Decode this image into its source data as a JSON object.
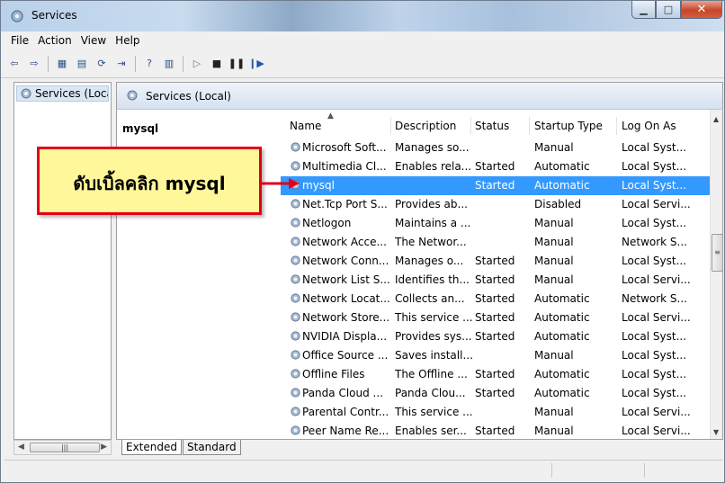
{
  "window": {
    "title": "Services"
  },
  "menu": [
    "File",
    "Action",
    "View",
    "Help"
  ],
  "tree": {
    "root_label": "Services (Loca"
  },
  "right_pane": {
    "header": "Services (Local)",
    "selected_service_name": "mysql"
  },
  "columns": [
    "Name",
    "Description",
    "Status",
    "Startup Type",
    "Log On As"
  ],
  "rows": [
    {
      "name": "Microsoft Soft...",
      "description": "Manages so...",
      "status": "",
      "startup": "Manual",
      "logon": "Local Syst..."
    },
    {
      "name": "Multimedia Cl...",
      "description": "Enables rela...",
      "status": "Started",
      "startup": "Automatic",
      "logon": "Local Syst..."
    },
    {
      "name": "mysql",
      "description": "",
      "status": "Started",
      "startup": "Automatic",
      "logon": "Local Syst...",
      "selected": true
    },
    {
      "name": "Net.Tcp Port S...",
      "description": "Provides ab...",
      "status": "",
      "startup": "Disabled",
      "logon": "Local Servi..."
    },
    {
      "name": "Netlogon",
      "description": "Maintains a ...",
      "status": "",
      "startup": "Manual",
      "logon": "Local Syst..."
    },
    {
      "name": "Network Acce...",
      "description": "The Networ...",
      "status": "",
      "startup": "Manual",
      "logon": "Network S..."
    },
    {
      "name": "Network Conn...",
      "description": "Manages o...",
      "status": "Started",
      "startup": "Manual",
      "logon": "Local Syst..."
    },
    {
      "name": "Network List S...",
      "description": "Identifies th...",
      "status": "Started",
      "startup": "Manual",
      "logon": "Local Servi..."
    },
    {
      "name": "Network Locat...",
      "description": "Collects an...",
      "status": "Started",
      "startup": "Automatic",
      "logon": "Network S..."
    },
    {
      "name": "Network Store...",
      "description": "This service ...",
      "status": "Started",
      "startup": "Automatic",
      "logon": "Local Servi..."
    },
    {
      "name": "NVIDIA Displa...",
      "description": "Provides sys...",
      "status": "Started",
      "startup": "Automatic",
      "logon": "Local Syst..."
    },
    {
      "name": "Office Source ...",
      "description": "Saves install...",
      "status": "",
      "startup": "Manual",
      "logon": "Local Syst..."
    },
    {
      "name": "Offline Files",
      "description": "The Offline ...",
      "status": "Started",
      "startup": "Automatic",
      "logon": "Local Syst..."
    },
    {
      "name": "Panda Cloud ...",
      "description": "Panda Clou...",
      "status": "Started",
      "startup": "Automatic",
      "logon": "Local Syst..."
    },
    {
      "name": "Parental Contr...",
      "description": "This service ...",
      "status": "",
      "startup": "Manual",
      "logon": "Local Servi..."
    },
    {
      "name": "Peer Name Re...",
      "description": "Enables ser...",
      "status": "Started",
      "startup": "Manual",
      "logon": "Local Servi..."
    }
  ],
  "tabs": [
    "Extended",
    "Standard"
  ],
  "annotation": {
    "text": "ดับเบิ้ลคลิก mysql"
  },
  "colors": {
    "selection": "#3399ff",
    "callout_fill": "#fff79a",
    "callout_border": "#e1001a"
  },
  "icons": [
    "services-app-icon",
    "back-arrow-icon",
    "forward-arrow-icon",
    "console-tree-icon",
    "properties-icon",
    "refresh-icon",
    "export-icon",
    "help-icon",
    "show-hide-icon",
    "play-icon",
    "stop-icon",
    "pause-icon",
    "resume-icon",
    "service-gear-icon"
  ]
}
